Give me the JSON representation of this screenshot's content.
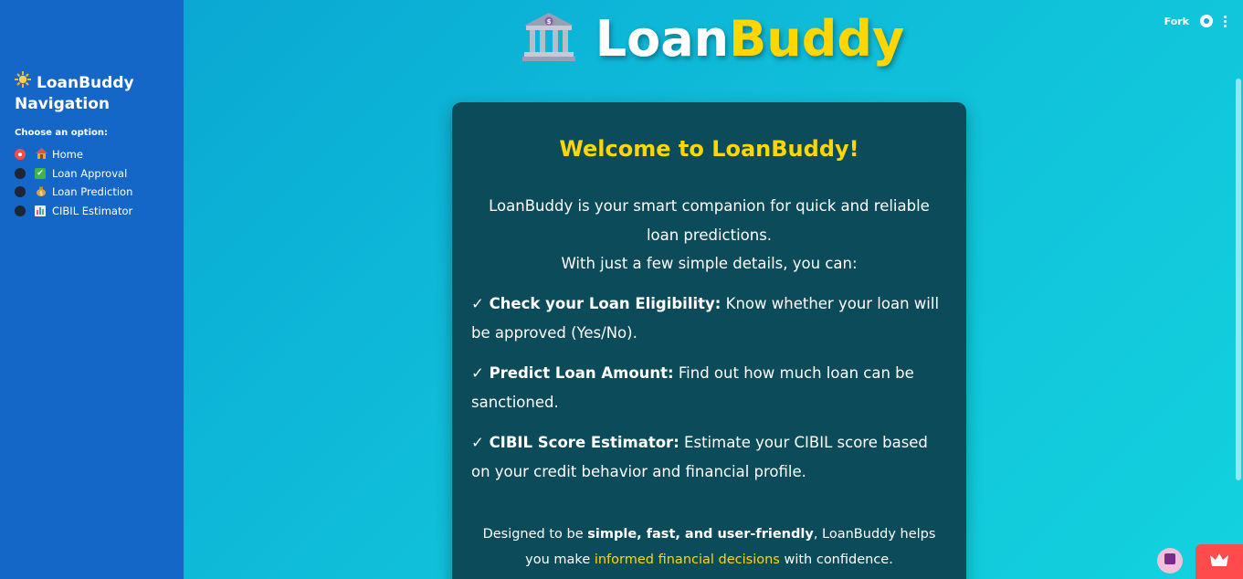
{
  "colors": {
    "sidebar_bg": "#1467c7",
    "card_bg": "#0c4c5a",
    "accent_yellow": "#ffd700",
    "radio_checked": "#ff4b4b"
  },
  "sidebar": {
    "title": "LoanBuddy Navigation",
    "title_icon": "sun-icon",
    "choose_label": "Choose an option:",
    "options": [
      {
        "icon": "house-icon",
        "label": "Home",
        "selected": true
      },
      {
        "icon": "check-mark-icon",
        "label": "Loan Approval",
        "selected": false
      },
      {
        "icon": "money-bag-icon",
        "label": "Loan Prediction",
        "selected": false
      },
      {
        "icon": "bar-chart-icon",
        "label": "CIBIL Estimator",
        "selected": false
      }
    ]
  },
  "header": {
    "fork_label": "Fork",
    "github_icon": "github-icon",
    "menu_icon": "kebab-menu-icon"
  },
  "app_title": {
    "icon": "bank-icon",
    "part1": "Loan",
    "part2": "Buddy"
  },
  "card": {
    "title": "Welcome to LoanBuddy!",
    "intro_line1": "LoanBuddy is your smart companion for quick and reliable loan predictions.",
    "intro_line2": "With just a few simple details, you can:",
    "features": [
      {
        "check": "✓",
        "bold": "Check your Loan Eligibility:",
        "text": " Know whether your loan will be approved (Yes/No)."
      },
      {
        "check": "✓",
        "bold": "Predict Loan Amount:",
        "text": " Find out how much loan can be sanctioned."
      },
      {
        "check": "✓",
        "bold": "CIBIL Score Estimator:",
        "text": " Estimate your CIBIL score based on your credit behavior and financial profile."
      }
    ],
    "footer_prefix": "Designed to be ",
    "footer_bold": "simple, fast, and user-friendly",
    "footer_mid": ", LoanBuddy helps you make ",
    "footer_highlight": "informed financial decisions",
    "footer_suffix": " with confidence."
  }
}
